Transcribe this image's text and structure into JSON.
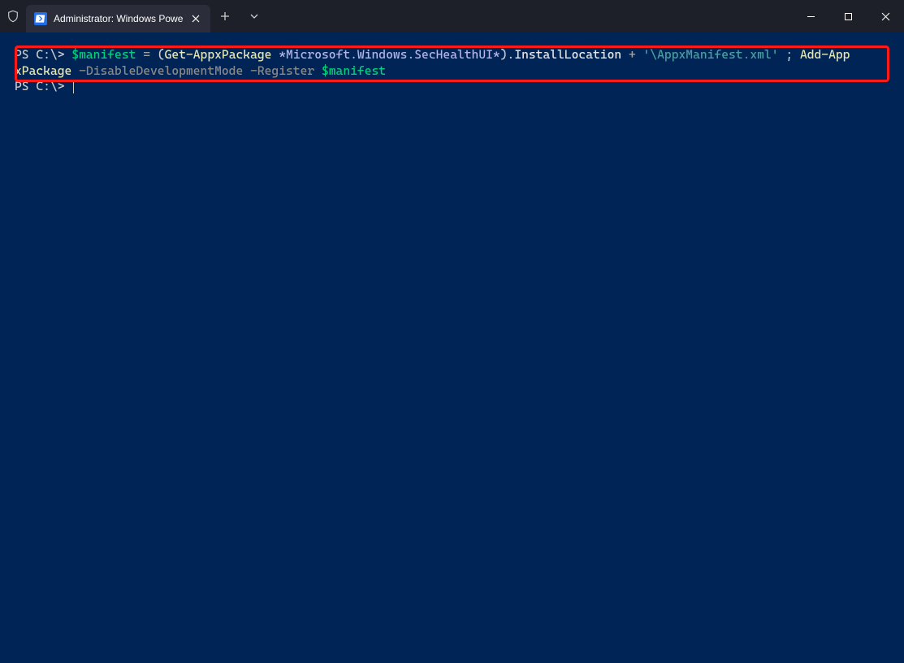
{
  "titlebar": {
    "tab_title": "Administrator: Windows Powe",
    "ps_glyph": ">_"
  },
  "terminal": {
    "line1": {
      "prompt": "PS C:\\> ",
      "var1": "$manifest",
      "sp1": " ",
      "eq": "=",
      "sp2": " ",
      "lp": "(",
      "cmd1": "Get-AppxPackage",
      "sp3": " ",
      "arg1": "*Microsoft.Windows.SecHealthUI*",
      "rp": ")",
      "dot": ".",
      "member": "InstallLocation",
      "sp4": " ",
      "plus": "+",
      "sp5": " ",
      "str": "'\\AppxManifest.xml'",
      "sp6": " ",
      "semi": ";",
      "sp7": " ",
      "cmd2a": "Add-App"
    },
    "line2": {
      "cmd2b": "xPackage",
      "sp1": " ",
      "param1": "-DisableDevelopmentMode",
      "sp2": " ",
      "param2": "-Register",
      "sp3": " ",
      "var2": "$manifest"
    },
    "line3": {
      "prompt": "PS C:\\> "
    }
  }
}
